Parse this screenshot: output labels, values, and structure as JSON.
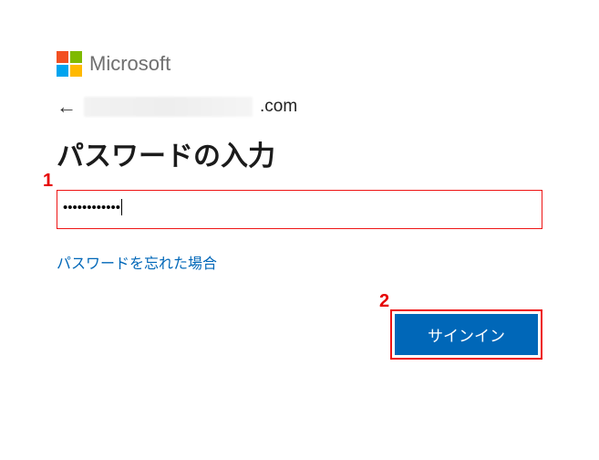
{
  "brand": {
    "name": "Microsoft"
  },
  "identity": {
    "suffix": ".com"
  },
  "title": "パスワードの入力",
  "password": {
    "masked": "••••••••••••"
  },
  "links": {
    "forgot": "パスワードを忘れた場合"
  },
  "buttons": {
    "signin": "サインイン"
  },
  "callouts": {
    "one": "1",
    "two": "2"
  }
}
